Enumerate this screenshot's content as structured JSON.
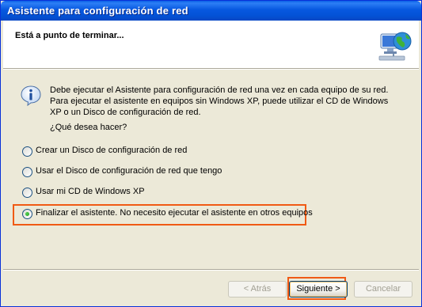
{
  "window": {
    "title": "Asistente para configuración de red"
  },
  "header": {
    "title": "Está a punto de terminar...",
    "icon": "network-globe-icon"
  },
  "info": {
    "icon": "info-icon",
    "lines": [
      "Debe ejecutar el Asistente para configuración de red una vez en cada equipo de su red.",
      "Para ejecutar el asistente en equipos sin Windows XP, puede utilizar el CD de Windows",
      "XP o un Disco de configuración de red."
    ],
    "question": "¿Qué desea hacer?"
  },
  "options": [
    {
      "label": "Crear un Disco de configuración de red",
      "selected": false
    },
    {
      "label": "Usar el Disco de configuración de red que tengo",
      "selected": false
    },
    {
      "label": "Usar mi CD de Windows XP",
      "selected": false
    },
    {
      "label": "Finalizar el asistente. No necesito ejecutar el asistente en otros equipos",
      "selected": true
    }
  ],
  "buttons": {
    "back": "< Atrás",
    "next": "Siguiente >",
    "cancel": "Cancelar"
  },
  "colors": {
    "titlebar": "#0758e0",
    "highlight": "#f05a14",
    "dialog_bg": "#ece9d8"
  }
}
